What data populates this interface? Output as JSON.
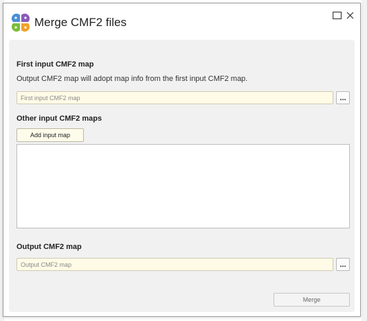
{
  "window": {
    "title": "Merge CMF2 files",
    "icons": {
      "app_logo": "four-petal-logo-icon",
      "maximize": "maximize-icon",
      "close": "close-icon"
    }
  },
  "first_input": {
    "label": "First input CMF2 map",
    "info": "Output CMF2 map will adopt map info from the first input CMF2 map.",
    "value": "",
    "placeholder": "First input CMF2 map",
    "browse_label": "..."
  },
  "other_inputs": {
    "label": "Other input CMF2 maps",
    "add_button_label": "Add input map",
    "items": []
  },
  "output": {
    "label": "Output CMF2 map",
    "value": "",
    "placeholder": "Output CMF2 map",
    "browse_label": "..."
  },
  "actions": {
    "merge_label": "Merge"
  },
  "colors": {
    "logo_blue": "#4a8fd6",
    "logo_purple": "#8a5bb8",
    "logo_green": "#7cbc3a",
    "logo_orange": "#f1a12a",
    "input_bg": "#fffbe6"
  }
}
